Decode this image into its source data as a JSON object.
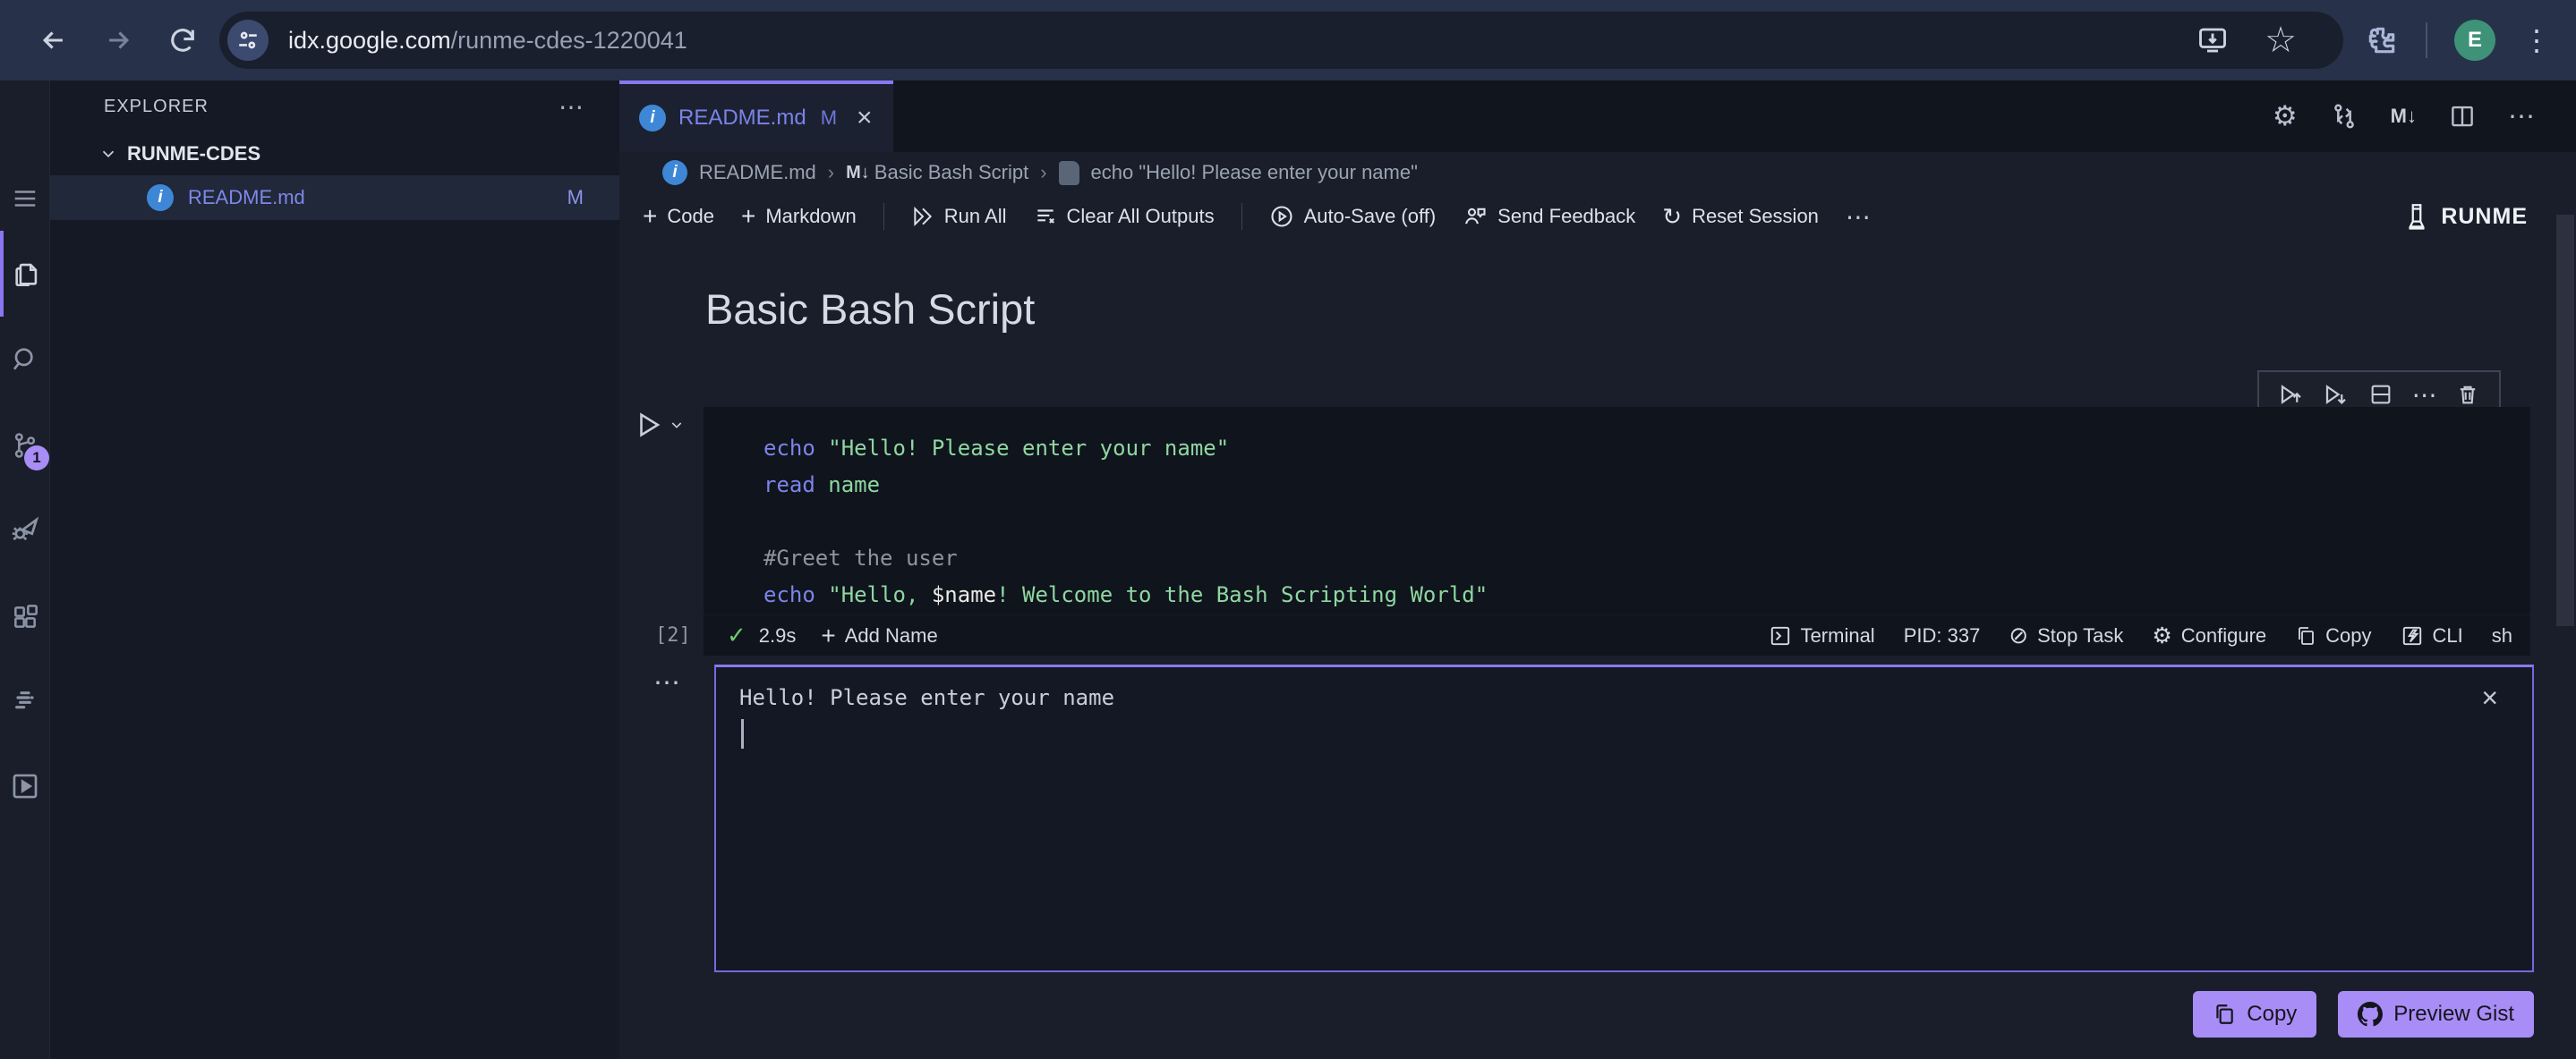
{
  "browser": {
    "url_host": "idx.google.com",
    "url_path": "/runme-cdes-1220041",
    "avatar_letter": "E"
  },
  "activity_bar": {
    "scm_badge": "1"
  },
  "explorer": {
    "title": "EXPLORER",
    "folder": "RUNME-CDES",
    "file": {
      "name": "README.md",
      "badge": "M"
    }
  },
  "tab": {
    "label": "README.md",
    "badge": "M"
  },
  "editor_actions": {
    "markdown_glyph": "M↓"
  },
  "breadcrumb": {
    "file": "README.md",
    "markdown_glyph": "M↓",
    "heading": "Basic Bash Script",
    "cell": "echo \"Hello! Please enter your name\""
  },
  "notebook_toolbar": {
    "code": "Code",
    "markdown": "Markdown",
    "run_all": "Run All",
    "clear_outputs": "Clear All Outputs",
    "autosave": "Auto-Save (off)",
    "feedback": "Send Feedback",
    "reset": "Reset Session",
    "brand": "RUNME"
  },
  "document": {
    "title": "Basic Bash Script"
  },
  "cell": {
    "execution_count": "[2]",
    "code_lines": [
      {
        "tokens": [
          {
            "c": "kw",
            "v": "echo "
          },
          {
            "c": "str",
            "v": "\"Hello! Please enter your name\""
          }
        ]
      },
      {
        "tokens": [
          {
            "c": "kw",
            "v": "read "
          },
          {
            "c": "str",
            "v": "name"
          }
        ]
      },
      {
        "tokens": []
      },
      {
        "tokens": [
          {
            "c": "com",
            "v": "#Greet the user"
          }
        ]
      },
      {
        "tokens": [
          {
            "c": "kw",
            "v": "echo "
          },
          {
            "c": "str",
            "v": "\"Hello, "
          },
          {
            "c": "var",
            "v": "$name"
          },
          {
            "c": "str",
            "v": "! Welcome to the Bash Scripting World\""
          }
        ]
      }
    ],
    "status": {
      "duration": "2.9s",
      "add_name": "Add Name",
      "terminal": "Terminal",
      "pid": "PID: 337",
      "stop": "Stop Task",
      "configure": "Configure",
      "copy": "Copy",
      "cli": "CLI",
      "shell": "sh"
    }
  },
  "output": {
    "text": "Hello! Please enter your name"
  },
  "actions": {
    "copy": "Copy",
    "preview_gist": "Preview Gist"
  },
  "icons": {
    "more_h": "⋯",
    "more_v": "⋮",
    "gear": "⚙",
    "star": "☆",
    "plus": "+",
    "check": "✓",
    "close": "×",
    "reset": "↻",
    "stop": "⊘"
  },
  "colors": {
    "accent_purple": "#8a76f0",
    "button_purple": "#a98df6",
    "tab_link": "#7b83e8",
    "info_blue": "#3e87d6",
    "check_green": "#6fc96f",
    "code_keyword": "#7d84e8",
    "code_string": "#8fd7a0",
    "avatar_green": "#3e9277"
  }
}
